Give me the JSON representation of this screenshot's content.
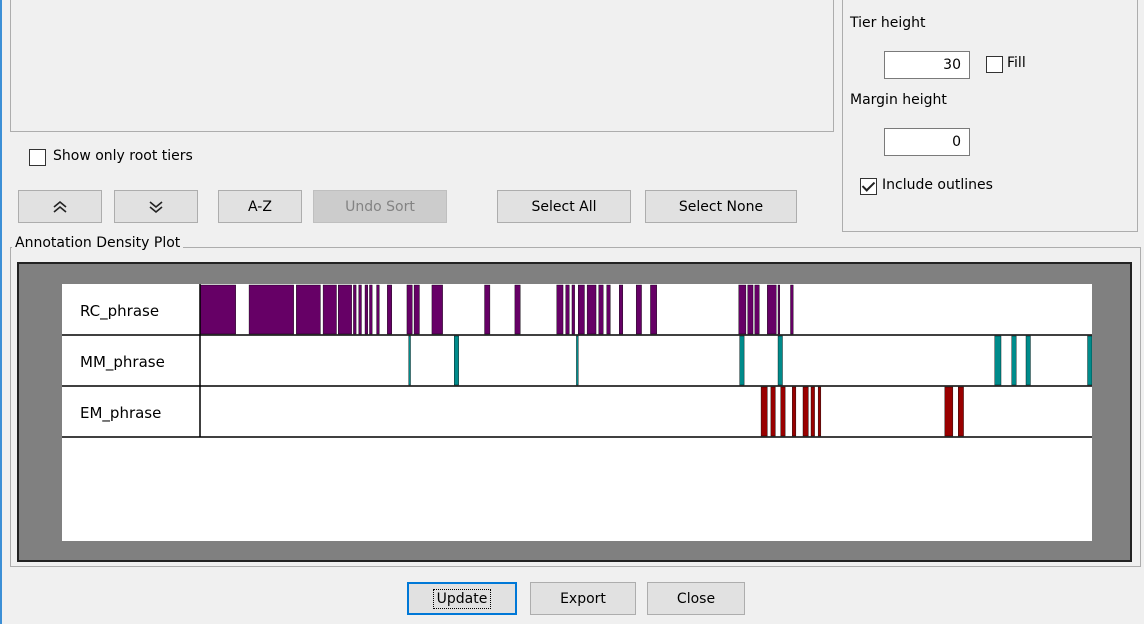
{
  "tier_settings": {
    "tier_height_label": "Tier height",
    "tier_height_value": "30",
    "fill_label": "Fill",
    "fill_checked": false,
    "margin_height_label": "Margin height",
    "margin_height_value": "0",
    "include_outlines_label": "Include outlines",
    "include_outlines_checked": true
  },
  "tier_selection": {
    "show_only_root_label": "Show only root tiers",
    "show_only_root_checked": false,
    "move_up_icon": "double-chevron-up-icon",
    "move_down_icon": "double-chevron-down-icon",
    "sort_az_label": "A-Z",
    "undo_sort_label": "Undo Sort",
    "select_all_label": "Select All",
    "select_none_label": "Select None"
  },
  "plot": {
    "title": "Annotation Density Plot",
    "timeline_max": 1000,
    "tiers": [
      {
        "name": "RC_phrase",
        "color": "#660066",
        "segments": [
          [
            0,
            40
          ],
          [
            55,
            105
          ],
          [
            108,
            135
          ],
          [
            138,
            153
          ],
          [
            155,
            170
          ],
          [
            172,
            175
          ],
          [
            178,
            181
          ],
          [
            185,
            188
          ],
          [
            190,
            193
          ],
          [
            198,
            201
          ],
          [
            210,
            215
          ],
          [
            232,
            238
          ],
          [
            240,
            246
          ],
          [
            260,
            272
          ],
          [
            319,
            325
          ],
          [
            353,
            359
          ],
          [
            400,
            407
          ],
          [
            410,
            414
          ],
          [
            417,
            420
          ],
          [
            424,
            431
          ],
          [
            434,
            444
          ],
          [
            447,
            452
          ],
          [
            456,
            460
          ],
          [
            470,
            474
          ],
          [
            489,
            495
          ],
          [
            505,
            512
          ],
          [
            604,
            612
          ],
          [
            614,
            620
          ],
          [
            622,
            627
          ],
          [
            636,
            646
          ],
          [
            648,
            650
          ],
          [
            662,
            665
          ]
        ]
      },
      {
        "name": "MM_phrase",
        "color": "#008b8b",
        "segments": [
          [
            234,
            236
          ],
          [
            285,
            290
          ],
          [
            422,
            424
          ],
          [
            605,
            610
          ],
          [
            648,
            653
          ],
          [
            891,
            898
          ],
          [
            910,
            915
          ],
          [
            926,
            931
          ],
          [
            995,
            1000
          ]
        ]
      },
      {
        "name": "EM_phrase",
        "color": "#990000",
        "segments": [
          [
            629,
            636
          ],
          [
            640,
            645
          ],
          [
            651,
            656
          ],
          [
            664,
            668
          ],
          [
            676,
            682
          ],
          [
            685,
            689
          ],
          [
            693,
            696
          ],
          [
            835,
            844
          ],
          [
            850,
            856
          ]
        ]
      }
    ]
  },
  "bottom_buttons": {
    "update_label": "Update",
    "export_label": "Export",
    "close_label": "Close"
  }
}
